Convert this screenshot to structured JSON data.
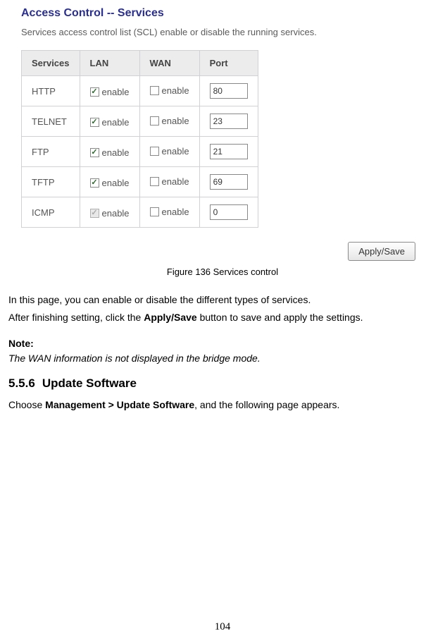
{
  "panel": {
    "title": "Access Control -- Services",
    "subtitle": "Services access control list (SCL) enable or disable the running services.",
    "headers": {
      "services": "Services",
      "lan": "LAN",
      "wan": "WAN",
      "port": "Port"
    },
    "enable_label": "enable",
    "rows": [
      {
        "name": "HTTP",
        "lan_checked": true,
        "lan_disabled": false,
        "wan_checked": false,
        "port": "80"
      },
      {
        "name": "TELNET",
        "lan_checked": true,
        "lan_disabled": false,
        "wan_checked": false,
        "port": "23"
      },
      {
        "name": "FTP",
        "lan_checked": true,
        "lan_disabled": false,
        "wan_checked": false,
        "port": "21"
      },
      {
        "name": "TFTP",
        "lan_checked": true,
        "lan_disabled": false,
        "wan_checked": false,
        "port": "69"
      },
      {
        "name": "ICMP",
        "lan_checked": true,
        "lan_disabled": true,
        "wan_checked": false,
        "port": "0"
      }
    ],
    "apply_label": "Apply/Save"
  },
  "figure_caption": "Figure 136 Services control",
  "para1": "In this page, you can enable or disable the different types of services.",
  "para2_a": "After finishing setting, click the ",
  "para2_b": "Apply/Save",
  "para2_c": " button to save and apply the settings.",
  "note_label": "Note:",
  "note_body": "The WAN information is not displayed in the bridge mode.",
  "section": {
    "number": "5.5.6",
    "title": "Update Software"
  },
  "section_para_a": "Choose ",
  "section_para_b": "Management > Update Software",
  "section_para_c": ", and the following page appears.",
  "page_number": "104"
}
